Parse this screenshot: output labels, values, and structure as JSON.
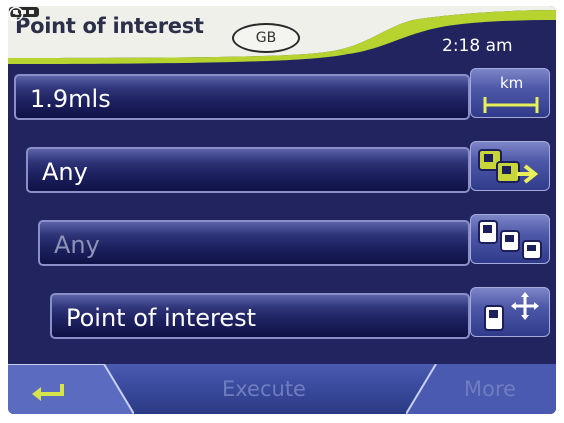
{
  "header": {
    "title": "Point of interest",
    "country": "GB",
    "time": "2:18 am",
    "battery_icon": "battery-icon",
    "clock_icon": "clock-icon"
  },
  "fields": {
    "distance": {
      "value": "1.9mls",
      "button_label": "km",
      "button_icon": "ruler-icon"
    },
    "city": {
      "value": "Any",
      "button_icon": "city-select-icon"
    },
    "street": {
      "value": "Any",
      "button_icon": "street-select-icon",
      "disabled": true
    },
    "category": {
      "value": "Point of interest",
      "button_icon": "poi-category-icon"
    }
  },
  "footer": {
    "back_icon": "back-icon",
    "execute_label": "Execute",
    "more_label": "More"
  },
  "colors": {
    "header_bg": "#f0f0ea",
    "accent_green": "#b6d330",
    "screen_bg": "#21245f",
    "footer_bg": "#3a4b9e",
    "disabled_text": "#6e7dbf"
  }
}
